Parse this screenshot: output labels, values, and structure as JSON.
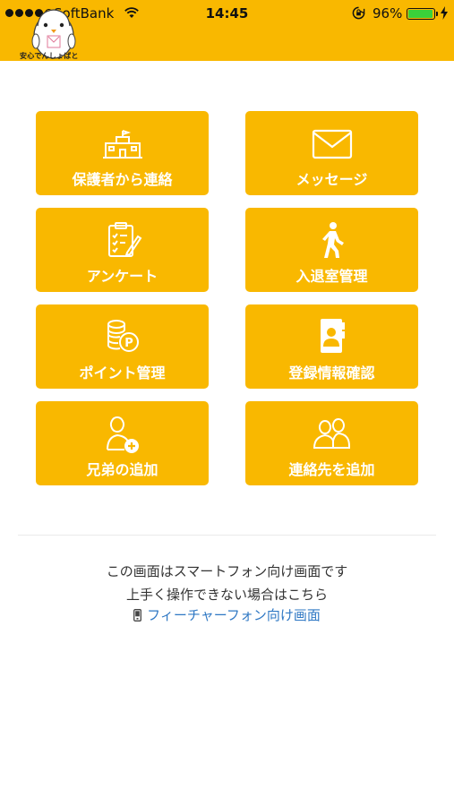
{
  "status_bar": {
    "carrier": "SoftBank",
    "time": "14:45",
    "battery_percent": "96%",
    "battery_level": 0.96,
    "signal_bars_filled": 4
  },
  "app": {
    "logo_text": "安心でんしょばと",
    "brand_color": "#f9b800",
    "link_color": "#2f78c4"
  },
  "menu": {
    "items": [
      {
        "label": "保護者から連絡",
        "icon": "school-icon"
      },
      {
        "label": "メッセージ",
        "icon": "envelope-icon"
      },
      {
        "label": "アンケート",
        "icon": "clipboard-pen-icon"
      },
      {
        "label": "入退室管理",
        "icon": "walking-person-icon"
      },
      {
        "label": "ポイント管理",
        "icon": "coins-point-icon"
      },
      {
        "label": "登録情報確認",
        "icon": "id-card-icon"
      },
      {
        "label": "兄弟の追加",
        "icon": "add-user-icon"
      },
      {
        "label": "連絡先を追加",
        "icon": "contacts-group-icon"
      }
    ]
  },
  "footer": {
    "line1": "この画面はスマートフォン向け画面です",
    "line2": "上手く操作できない場合はこちら",
    "link_label": "フィーチャーフォン向け画面",
    "link_icon": "mobile-phone-icon"
  }
}
